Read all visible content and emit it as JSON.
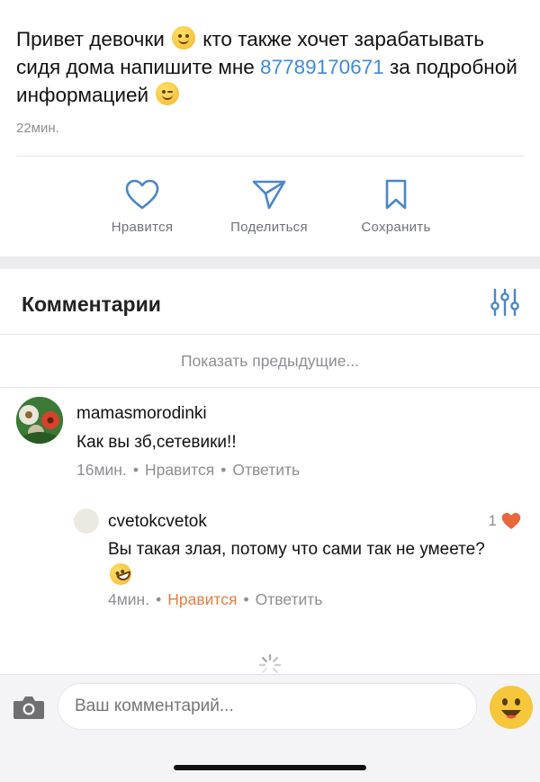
{
  "post": {
    "text_part1": "Привет девочки ",
    "text_part2": " кто также хочет зарабатывать сидя дома напишите мне ",
    "phone": "87789170671",
    "text_part3": " за подробной информацией ",
    "emoji1": "hugging-face-icon",
    "emoji2": "winking-face-icon",
    "time": "22мин."
  },
  "actions": {
    "like_label": "Нравится",
    "share_label": "Поделиться",
    "save_label": "Сохранить"
  },
  "comments": {
    "title": "Комментарии",
    "show_previous": "Показать предыдущие...",
    "items": [
      {
        "author": "mamasmorodinki",
        "text": "Как вы зб,сетевики!!",
        "time": "16мин.",
        "like": "Нравится",
        "reply": "Ответить"
      },
      {
        "author": "cvetokcvetok",
        "text": "Вы такая злая, потому что сами так не умеете?",
        "emoji": "rolling-laughing-icon",
        "time": "4мин.",
        "like": "Нравится",
        "reply": "Ответить",
        "like_count": "1"
      }
    ]
  },
  "composer": {
    "placeholder": "Ваш комментарий..."
  },
  "colors": {
    "link": "#3f8ad8",
    "liked": "#e87d3e",
    "muted": "#8e8e93"
  }
}
